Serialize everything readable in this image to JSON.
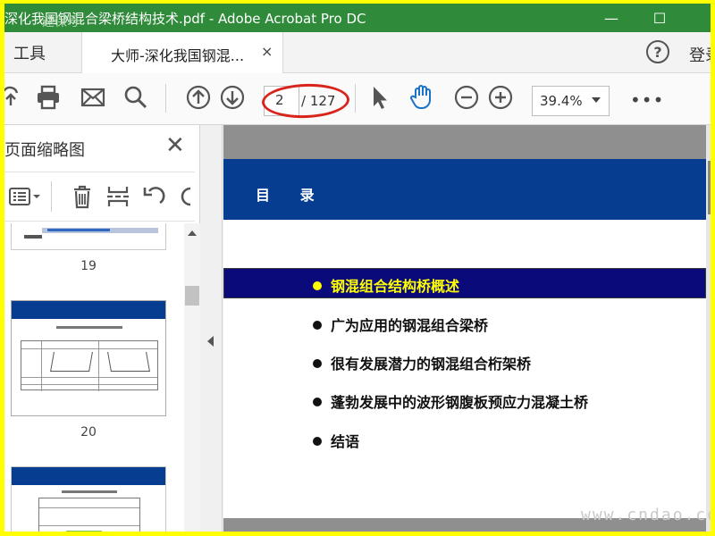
{
  "window": {
    "title": "深化我国钢混合梁桥结构技术.pdf - Adobe Acrobat Pro DC",
    "minimize": "—",
    "maximize": "☐",
    "watermark_tl": "速保号"
  },
  "tabs": {
    "tools_label": "工具",
    "doc_tab_label": "大师-深化我国钢混...",
    "doc_tab_close": "×",
    "help_icon": "?",
    "login_label": "登录"
  },
  "toolbar": {
    "icons": [
      "upload-icon",
      "print-icon",
      "mail-icon",
      "search-icon",
      "prev-page-icon",
      "next-page-icon",
      "select-icon",
      "hand-icon",
      "zoom-out-icon",
      "zoom-in-icon"
    ],
    "current_page": "2",
    "page_total": "/ 127",
    "zoom_value": "39.4%",
    "more_label": "•••"
  },
  "panel": {
    "title": "页面缩略图",
    "close_label": "✕",
    "thumbnails": [
      {
        "page_number": "19"
      },
      {
        "page_number": "20"
      }
    ]
  },
  "document": {
    "header_title": "目 录",
    "bullets": [
      {
        "text": "钢混组合结构桥概述",
        "highlighted": true
      },
      {
        "text": "广为应用的钢混组合梁桥",
        "highlighted": false
      },
      {
        "text": "很有发展潜力的钢混组合桁架桥",
        "highlighted": false
      },
      {
        "text": "蓬勃发展中的波形钢腹板预应力混凝土桥",
        "highlighted": false
      },
      {
        "text": "结语",
        "highlighted": false
      }
    ],
    "colors": {
      "header_bg": "#073d91",
      "highlight_bg": "#0a0a7a",
      "highlight_text": "#ffff00",
      "body_text": "#111111"
    }
  },
  "footer": {
    "watermark": "www.cndao.com"
  }
}
